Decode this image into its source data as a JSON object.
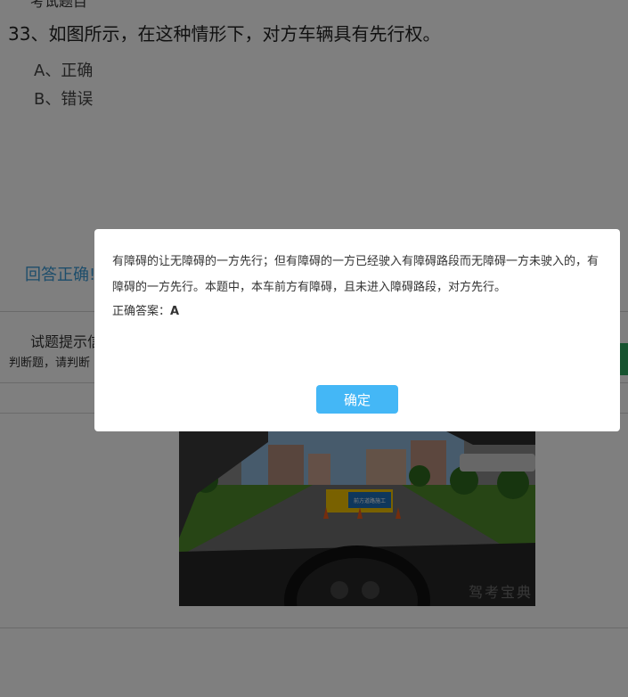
{
  "exam": {
    "header": "考试题目",
    "question": "33、如图所示，在这种情形下，对方车辆具有先行权。",
    "options": [
      {
        "label": "A、正确"
      },
      {
        "label": "B、错误"
      }
    ]
  },
  "result": {
    "text": "回答正确!"
  },
  "hint": {
    "title": "试题提示信",
    "body": "判断题，请判断"
  },
  "scene": {
    "sign_text": "前方道路施工",
    "watermark": "驾考宝典"
  },
  "modal": {
    "explanation": "有障碍的让无障碍的一方先行；但有障碍的一方已经驶入有障碍路段而无障碍一方未驶入的，有障碍的一方先行。本题中，本车前方有障碍，且未进入障碍路段，对方先行。",
    "correct_label": "正确答案：",
    "correct_value": "A",
    "confirm_label": "确定"
  },
  "colors": {
    "accent": "#44b7f6",
    "result_text": "#3a9bd6",
    "overlay": "rgba(0,0,0,0.5)",
    "green_tab": "#2fa860"
  }
}
